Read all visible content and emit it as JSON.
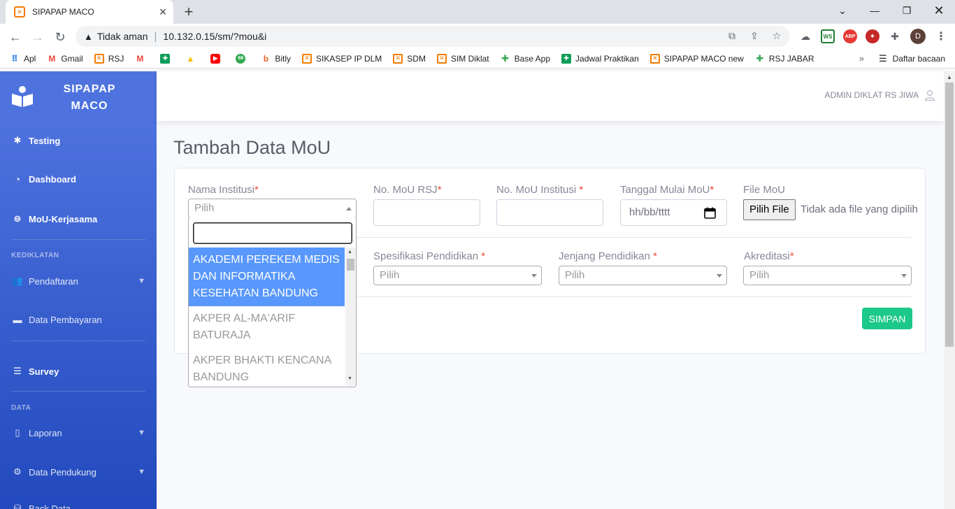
{
  "browser": {
    "tab_title": "SIPAPAP MACO",
    "not_secure": "Tidak aman",
    "url": "10.132.0.15/sm/?mou&i",
    "profile_initial": "D",
    "bookmarks": [
      "Apl",
      "Gmail",
      "RSJ",
      "",
      "",
      "",
      "",
      "",
      "Bitly",
      "SIKASEP IP DLM",
      "SDM",
      "SIM Diklat",
      "Base App",
      "Jadwal Praktikan",
      "SIPAPAP MACO new",
      "RSJ JABAR"
    ],
    "reading_list": "Daftar bacaan",
    "ext_labels": [
      "WS",
      "ABP"
    ]
  },
  "sidebar": {
    "brand_line1": "SIPAPAP",
    "brand_line2": "MACO",
    "items": [
      {
        "label": "Testing",
        "icon": "bug-icon"
      },
      {
        "label": "Dashboard",
        "icon": "tachometer-icon"
      },
      {
        "label": "MoU-Kerjasama",
        "icon": "handshake-icon"
      },
      {
        "label": "Pendaftaran",
        "icon": "users-icon"
      },
      {
        "label": "Data Pembayaran",
        "icon": "wallet-icon"
      },
      {
        "label": "Survey",
        "icon": "list-icon"
      },
      {
        "label": "Laporan",
        "icon": "file-icon"
      },
      {
        "label": "Data Pendukung",
        "icon": "cog-icon"
      },
      {
        "label": "Back Data",
        "icon": "database-icon"
      }
    ],
    "heading_kediklatan": "KEDIKLATAN",
    "heading_data": "DATA"
  },
  "topbar": {
    "user": "ADMIN DIKLAT RS JIWA"
  },
  "page": {
    "title": "Tambah Data MoU"
  },
  "form": {
    "nama_institusi": {
      "label": "Nama Institusi",
      "placeholder": "Pilih"
    },
    "no_mou_rsj": {
      "label": "No. MoU RSJ"
    },
    "no_mou_institusi": {
      "label": "No. MoU Institusi "
    },
    "tanggal_mulai": {
      "label": "Tanggal Mulai MoU",
      "placeholder": "hh/bb/tttt"
    },
    "file_mou": {
      "label": "File MoU",
      "button": "Pilih File",
      "status": "Tidak ada file yang dipilih"
    },
    "spesifikasi": {
      "label": "Spesifikasi Pendidikan ",
      "placeholder": "Pilih"
    },
    "jenjang": {
      "label": "Jenjang Pendidikan ",
      "placeholder": "Pilih"
    },
    "akreditasi": {
      "label": "Akreditasi",
      "placeholder": "Pilih"
    },
    "required_mark": "*",
    "save_button": "SIMPAN"
  },
  "dropdown": {
    "options": [
      "AKADEMI PEREKEM MEDIS DAN INFORMATIKA KESEHATAN BANDUNG",
      "AKPER AL-MA'ARIF BATURAJA",
      "AKPER BHAKTI KENCANA BANDUNG"
    ],
    "highlighted_index": 0
  },
  "colors": {
    "sidebar": "#4e73df",
    "success": "#1cc88a",
    "highlight": "#5897fb",
    "required": "#e74a3b"
  }
}
